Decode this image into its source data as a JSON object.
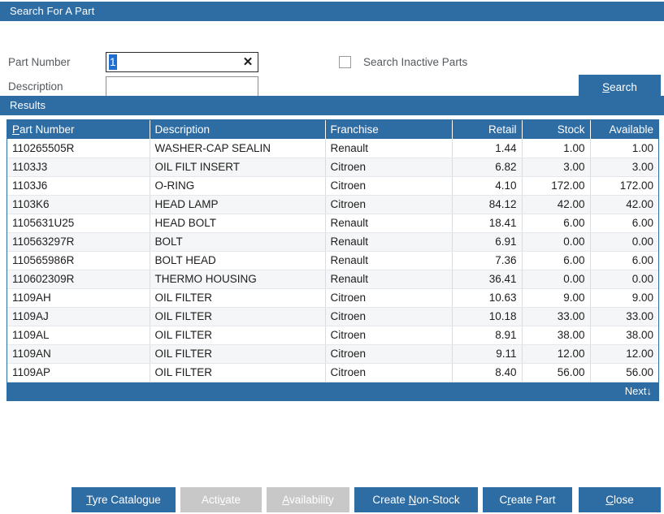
{
  "window": {
    "search_panel_title": "Search For A Part",
    "results_panel_title": "Results"
  },
  "search": {
    "part_number_label": "Part Number",
    "part_number_value": "1",
    "part_number_placeholder": "",
    "description_label": "Description",
    "description_value": "",
    "description_placeholder": "",
    "clear_icon": "✕",
    "inactive_checkbox_label": "Search Inactive Parts",
    "inactive_checked": false,
    "search_button": {
      "prefix": "",
      "accel": "S",
      "suffix": "earch"
    }
  },
  "results": {
    "columns": [
      {
        "key": "part_number",
        "label_prefix": "",
        "accel": "P",
        "label_suffix": "art Number",
        "align": "left"
      },
      {
        "key": "description",
        "label_prefix": "Description",
        "accel": "",
        "label_suffix": "",
        "align": "left"
      },
      {
        "key": "franchise",
        "label_prefix": "Franchise",
        "accel": "",
        "label_suffix": "",
        "align": "left"
      },
      {
        "key": "retail",
        "label_prefix": "Retail",
        "accel": "",
        "label_suffix": "",
        "align": "right"
      },
      {
        "key": "stock",
        "label_prefix": "Stock",
        "accel": "",
        "label_suffix": "",
        "align": "right"
      },
      {
        "key": "available",
        "label_prefix": "Available",
        "accel": "",
        "label_suffix": "",
        "align": "right"
      }
    ],
    "rows": [
      {
        "part_number": "110265505R",
        "description": "WASHER-CAP SEALIN",
        "franchise": "Renault",
        "retail": "1.44",
        "stock": "1.00",
        "available": "1.00"
      },
      {
        "part_number": "1103J3",
        "description": "OIL FILT INSERT",
        "franchise": "Citroen",
        "retail": "6.82",
        "stock": "3.00",
        "available": "3.00"
      },
      {
        "part_number": "1103J6",
        "description": "O-RING",
        "franchise": "Citroen",
        "retail": "4.10",
        "stock": "172.00",
        "available": "172.00"
      },
      {
        "part_number": "1103K6",
        "description": "HEAD LAMP",
        "franchise": "Citroen",
        "retail": "84.12",
        "stock": "42.00",
        "available": "42.00"
      },
      {
        "part_number": "1105631U25",
        "description": "HEAD BOLT",
        "franchise": "Renault",
        "retail": "18.41",
        "stock": "6.00",
        "available": "6.00"
      },
      {
        "part_number": "110563297R",
        "description": "BOLT",
        "franchise": "Renault",
        "retail": "6.91",
        "stock": "0.00",
        "available": "0.00"
      },
      {
        "part_number": "110565986R",
        "description": "BOLT HEAD",
        "franchise": "Renault",
        "retail": "7.36",
        "stock": "6.00",
        "available": "6.00"
      },
      {
        "part_number": "110602309R",
        "description": "THERMO HOUSING",
        "franchise": "Renault",
        "retail": "36.41",
        "stock": "0.00",
        "available": "0.00"
      },
      {
        "part_number": "1109AH",
        "description": "OIL FILTER",
        "franchise": "Citroen",
        "retail": "10.63",
        "stock": "9.00",
        "available": "9.00"
      },
      {
        "part_number": "1109AJ",
        "description": "OIL FILTER",
        "franchise": "Citroen",
        "retail": "10.18",
        "stock": "33.00",
        "available": "33.00"
      },
      {
        "part_number": "1109AL",
        "description": "OIL FILTER",
        "franchise": "Citroen",
        "retail": "8.91",
        "stock": "38.00",
        "available": "38.00"
      },
      {
        "part_number": "1109AN",
        "description": "OIL FILTER",
        "franchise": "Citroen",
        "retail": "9.11",
        "stock": "12.00",
        "available": "12.00"
      },
      {
        "part_number": "1109AP",
        "description": "OIL FILTER",
        "franchise": "Citroen",
        "retail": "8.40",
        "stock": "56.00",
        "available": "56.00"
      }
    ],
    "next_label": "Next",
    "next_icon": "↓"
  },
  "buttons": [
    {
      "name": "tyre-catalogue",
      "prefix": "",
      "accel": "T",
      "suffix": "yre Catalogue",
      "disabled": false
    },
    {
      "name": "activate",
      "prefix": "Acti",
      "accel": "v",
      "suffix": "ate",
      "disabled": true
    },
    {
      "name": "availability",
      "prefix": "",
      "accel": "A",
      "suffix": "vailability",
      "disabled": true
    },
    {
      "name": "create-nonstock",
      "prefix": "Create ",
      "accel": "N",
      "suffix": "on-Stock",
      "disabled": false
    },
    {
      "name": "create-part",
      "prefix": "C",
      "accel": "r",
      "suffix": "eate Part",
      "disabled": false
    },
    {
      "name": "close",
      "prefix": "",
      "accel": "C",
      "suffix": "lose",
      "disabled": false
    }
  ],
  "colors": {
    "accent": "#2e6ca4",
    "disabled": "#c8c8c8",
    "selection": "#1f6fd0",
    "row_alt": "#f5f6f7",
    "label_text": "#555a5e"
  }
}
